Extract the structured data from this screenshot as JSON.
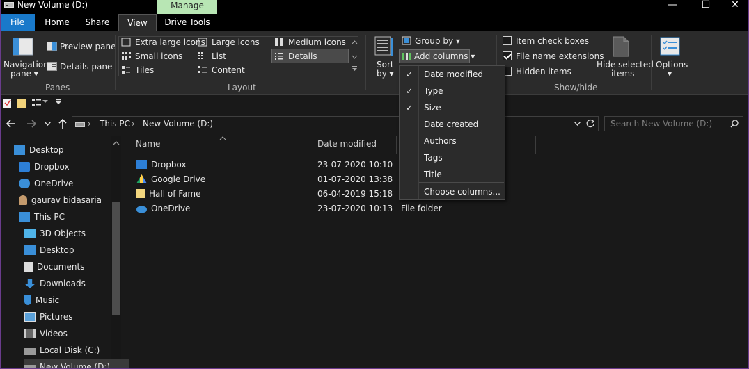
{
  "window": {
    "title": "New Volume (D:)",
    "minimize": "—",
    "maximize": "☐",
    "close": "✕"
  },
  "ribbon_tabs": {
    "file": "File",
    "home": "Home",
    "share": "Share",
    "view": "View",
    "manage": "Manage",
    "drive_tools": "Drive Tools"
  },
  "panes": {
    "navigation_pane": "Navigation",
    "navigation_pane_2": "pane ▾",
    "preview_pane": "Preview pane",
    "details_pane": "Details pane",
    "group_label": "Panes"
  },
  "layout": {
    "extra_large": "Extra large icons",
    "large": "Large icons",
    "medium": "Medium icons",
    "small": "Small icons",
    "list": "List",
    "details": "Details",
    "tiles": "Tiles",
    "content": "Content",
    "group_label": "Layout"
  },
  "current_view": {
    "sort_by": "Sort",
    "sort_by_2": "by ▾",
    "group_by": "Group by ▾",
    "add_columns": "Add columns ▾"
  },
  "show_hide": {
    "item_check_boxes": "Item check boxes",
    "file_name_extensions": "File name extensions",
    "hidden_items": "Hidden items",
    "hide_selected": "Hide selected",
    "hide_selected_2": "items",
    "group_label": "Show/hide"
  },
  "options": {
    "label": "Options",
    "arrow": "▾"
  },
  "address": {
    "path": [
      "This PC",
      "New Volume (D:)"
    ],
    "search_placeholder": "Search New Volume (D:)"
  },
  "nav_pane": [
    "Desktop",
    "Dropbox",
    "OneDrive",
    "gaurav bidasaria",
    "This PC",
    "3D Objects",
    "Desktop",
    "Documents",
    "Downloads",
    "Music",
    "Pictures",
    "Videos",
    "Local Disk (C:)",
    "New Volume (D:)"
  ],
  "columns": {
    "name": "Name",
    "date_modified": "Date modified"
  },
  "files": [
    {
      "name": "Dropbox",
      "date": "23-07-2020 10:10",
      "type": ""
    },
    {
      "name": "Google Drive",
      "date": "01-07-2020 13:38",
      "type": ""
    },
    {
      "name": "Hall of Fame",
      "date": "06-04-2019 15:18",
      "type": ""
    },
    {
      "name": "OneDrive",
      "date": "23-07-2020 10:13",
      "type": "File folder"
    }
  ],
  "menu": {
    "items": [
      "Date modified",
      "Type",
      "Size",
      "Date created",
      "Authors",
      "Tags",
      "Title"
    ],
    "choose": "Choose columns...",
    "check": "✓"
  },
  "colors": {
    "accent": "#1979ca",
    "manage": "#b8e6b4",
    "background": "#191919",
    "ribbon": "#2b2b2b"
  }
}
